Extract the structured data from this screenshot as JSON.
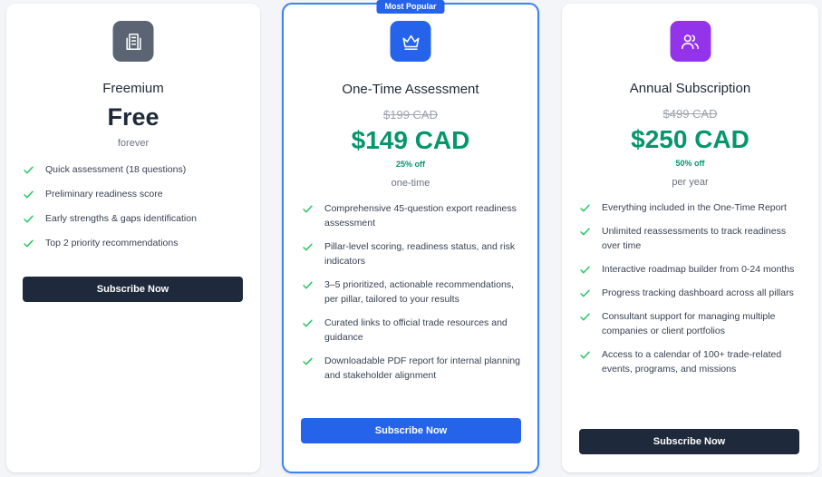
{
  "colors": {
    "accent_blue": "#2563eb",
    "price_green": "#059669",
    "dark_button": "#1e293b",
    "free_icon_bg": "#5b6472",
    "onetime_icon_bg": "#2563eb",
    "annual_icon_bg": "#9333ea"
  },
  "plans": [
    {
      "name": "Freemium",
      "icon": "building-document-icon",
      "price": "Free",
      "period": "forever",
      "features": [
        "Quick assessment (18 questions)",
        "Preliminary readiness score",
        "Early strengths & gaps identification",
        "Top 2 priority recommendations"
      ],
      "button_label": "Subscribe Now"
    },
    {
      "name": "One-Time Assessment",
      "badge": "Most Popular",
      "icon": "crown-icon",
      "old_price": "$199 CAD",
      "price": "$149 CAD",
      "discount": "25% off",
      "period": "one-time",
      "features": [
        "Comprehensive 45-question export readiness assessment",
        "Pillar-level scoring, readiness status, and risk indicators",
        "3–5 prioritized, actionable recommendations, per pillar, tailored to your results",
        "Curated links to official trade resources and guidance",
        "Downloadable PDF report for internal planning and stakeholder alignment"
      ],
      "button_label": "Subscribe Now"
    },
    {
      "name": "Annual Subscription",
      "icon": "users-icon",
      "old_price": "$499 CAD",
      "price": "$250 CAD",
      "discount": "50% off",
      "period": "per year",
      "features": [
        "Everything included in the One-Time Report",
        "Unlimited reassessments to track readiness over time",
        "Interactive roadmap builder from 0-24 months",
        "Progress tracking dashboard across all pillars",
        "Consultant support for managing multiple companies or client portfolios",
        "Access to a calendar of 100+ trade-related events, programs, and missions"
      ],
      "button_label": "Subscribe Now"
    }
  ]
}
